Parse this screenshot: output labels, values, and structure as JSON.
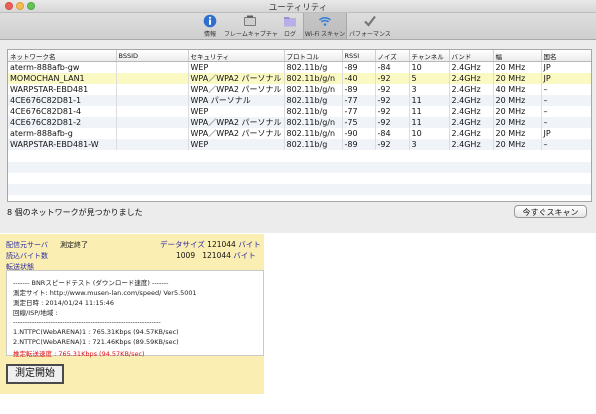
{
  "window": {
    "title": "ユーティリティ"
  },
  "toolbar": {
    "items": [
      {
        "label": "情報",
        "icon": "info-icon"
      },
      {
        "label": "フレームキャプチャ",
        "icon": "frame-capture-icon"
      },
      {
        "label": "ログ",
        "icon": "log-icon"
      },
      {
        "label": "Wi-Fi スキャン",
        "icon": "wifi-icon",
        "selected": true
      },
      {
        "label": "パフォーマンス",
        "icon": "performance-icon"
      }
    ]
  },
  "networks": {
    "columns": [
      "ネットワーク名",
      "BSSID",
      "セキュリティ",
      "プロトコル",
      "RSSI",
      "ノイズ",
      "チャンネル",
      "バンド",
      "幅",
      "国名"
    ],
    "rows": [
      [
        "aterm-888afb-gw",
        "",
        "WEP",
        "802.11b/g",
        "-89",
        "-84",
        "10",
        "2.4GHz",
        "20 MHz",
        "JP"
      ],
      [
        "MOMOCHAN_LAN1",
        "",
        "WPA／WPA2 パーソナル",
        "802.11b/g/n",
        "-40",
        "-92",
        "5",
        "2.4GHz",
        "20 MHz",
        "JP"
      ],
      [
        "WARPSTAR-EBD481",
        "",
        "WPA／WPA2 パーソナル",
        "802.11b/g/n",
        "-89",
        "-92",
        "3",
        "2.4GHz",
        "40 MHz",
        "–"
      ],
      [
        "4CE676C82D81-1",
        "",
        "WPA パーソナル",
        "802.11b/g",
        "-77",
        "-92",
        "11",
        "2.4GHz",
        "20 MHz",
        "–"
      ],
      [
        "4CE676C82D81-4",
        "",
        "WEP",
        "802.11b/g",
        "-77",
        "-92",
        "11",
        "2.4GHz",
        "20 MHz",
        "–"
      ],
      [
        "4CE676C82D81-2",
        "",
        "WPA／WPA2 パーソナル",
        "802.11b/g/n",
        "-75",
        "-92",
        "11",
        "2.4GHz",
        "20 MHz",
        "–"
      ],
      [
        "aterm-888afb-g",
        "",
        "WPA／WPA2 パーソナル",
        "802.11b/g/n",
        "-90",
        "-84",
        "10",
        "2.4GHz",
        "20 MHz",
        "JP"
      ],
      [
        "WARPSTAR-EBD481-W",
        "",
        "WEP",
        "802.11b/g",
        "-89",
        "-92",
        "3",
        "2.4GHz",
        "20 MHz",
        "–"
      ]
    ],
    "highlight_color": "#fbf9c3",
    "alt_row_color": "#f0f4f9"
  },
  "status": {
    "text": "8 個のネットワークが見つかりました"
  },
  "scan_button": {
    "label": "今すぐスキャン"
  },
  "speedtest": {
    "server_label": "配信元サーバ",
    "server_value": "測定終了",
    "read_bytes_label": "読込バイト数",
    "transfer_label": "転送状態",
    "data_size_label": "データサイズ",
    "data_size_value": "121044",
    "data_size_unit": "バイト",
    "read_count": "1009",
    "read_total": "121044",
    "read_unit": "バイト",
    "result_lines": [
      "------- BNRスピードテスト (ダウンロード速度) -------",
      "測定サイト: http://www.musen-lan.com/speed/ Ver5.5001",
      "測定日時 : 2014/01/24 11:15:46",
      "回線/ISP/地域 :",
      "---------------------------------------------------------------",
      "1.NTTPC(WebARENA)1 : 765.31Kbps (94.57KB/sec)",
      "2.NTTPC(WebARENA)1 : 721.46Kbps (89.59KB/sec)",
      "推定転送速度 : 765.31Kbps (94.57KB/sec)"
    ],
    "button_label": "測定開始",
    "panel_color": "#fbeeb3",
    "highlight_text_color": "#dd1111"
  }
}
